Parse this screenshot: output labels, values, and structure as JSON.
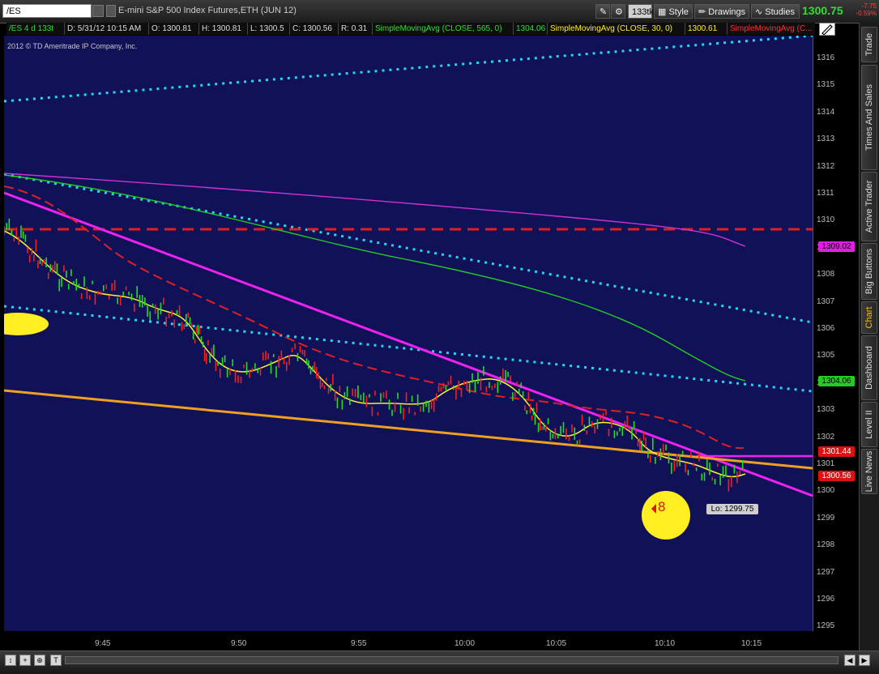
{
  "toolbar": {
    "symbol": "/ES",
    "description": "E-mini S&P 500 Index Futures,ETH (JUN 12)",
    "tick_button": "133tk",
    "style_label": "Style",
    "drawings_label": "Drawings",
    "studies_label": "Studies",
    "last_price": "1300.75",
    "net_change": "-7.75",
    "net_change_pct": "-0.59%"
  },
  "header": {
    "chart_id": "/ES 4 d 133t",
    "date": "D: 5/31/12 10:15 AM",
    "open": "O: 1300.81",
    "high": "H: 1300.81",
    "low": "L: 1300.5",
    "close": "C: 1300.56",
    "range": "R: 0.31",
    "sma1_label": "SimpleMovingAvg (CLOSE, 565, 0)",
    "sma1_value": "1304.06",
    "sma2_label": "SimpleMovingAvg (CLOSE, 30, 0)",
    "sma2_value": "1300.61",
    "sma3_label": "SimpleMovingAvg (C..."
  },
  "copyright": "2012 © TD Ameritrade IP Company, Inc.",
  "y_axis": {
    "ticks": [
      "1316",
      "1315",
      "1314",
      "1313",
      "1312",
      "1311",
      "1310",
      "1309",
      "1308",
      "1307",
      "1306",
      "1305",
      "1304",
      "1303",
      "1302",
      "1301",
      "1300",
      "1299",
      "1298",
      "1297",
      "1296",
      "1295"
    ],
    "bubbles": [
      {
        "value": "1309.02",
        "color": "#e020e0",
        "text_color": "#000"
      },
      {
        "value": "1304.06",
        "color": "#22cc22",
        "text_color": "#000"
      },
      {
        "value": "1301.44",
        "color": "#dd1111",
        "text_color": "#fff"
      },
      {
        "value": "1300.56",
        "color": "#dd1111",
        "text_color": "#fff"
      }
    ]
  },
  "x_axis": {
    "ticks": [
      "9:45",
      "9:50",
      "9:55",
      "10:00",
      "10:05",
      "10:10",
      "10:15"
    ]
  },
  "annotations": {
    "low_label": "Lo: 1299.75",
    "marker_number": "8"
  },
  "side_tabs": [
    "Trade",
    "Times And Sales",
    "Active Trader",
    "Big Buttons",
    "Chart",
    "Dashboard",
    "Level II",
    "Live News"
  ],
  "chart_data": {
    "type": "line",
    "title": "E-mini S&P 500 Index Futures,ETH (JUN 12)",
    "xlabel": "",
    "ylabel": "",
    "ylim": [
      1295,
      1316
    ],
    "x": [
      "9:45",
      "9:50",
      "9:55",
      "10:00",
      "10:05",
      "10:10",
      "10:15"
    ],
    "series": [
      {
        "name": "SimpleMovingAvg (CLOSE, 565, 0)",
        "color": "#22cc22",
        "last": 1304.06
      },
      {
        "name": "SimpleMovingAvg (CLOSE, 30, 0)",
        "color": "#ffee33",
        "last": 1300.61
      },
      {
        "name": "SimpleMovingAvg (C...",
        "color": "#dd1111",
        "last": 1301.44
      }
    ],
    "low": 1299.75,
    "last": 1300.56,
    "grid": false
  }
}
